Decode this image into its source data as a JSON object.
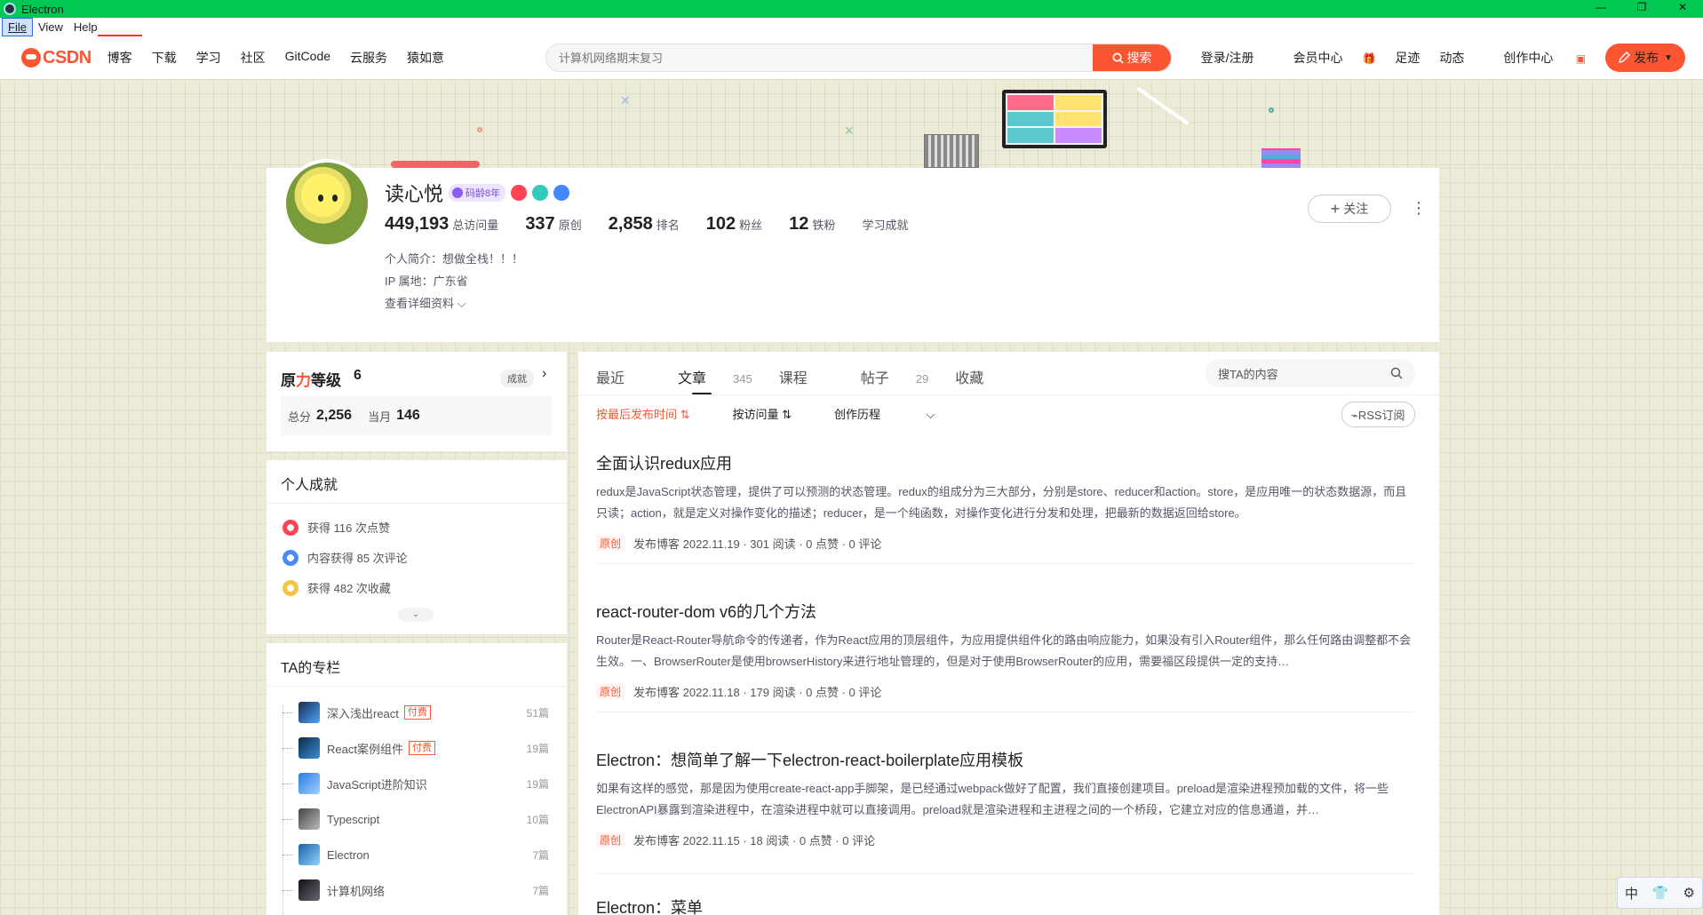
{
  "window": {
    "title": "Electron",
    "controls": [
      "—",
      "❐",
      "✕"
    ]
  },
  "menu": {
    "items": [
      "File",
      "View",
      "Help"
    ]
  },
  "toolbar": {
    "logo": "CSDN",
    "nav": [
      "博客",
      "下载",
      "学习",
      "社区",
      "GitCode",
      "云服务",
      "猿如意"
    ],
    "search_placeholder": "计算机网络期末复习",
    "search_button": "搜索",
    "right": [
      "登录/注册",
      "会员中心",
      "足迹",
      "动态",
      "创作中心"
    ],
    "publish": "发布"
  },
  "profile": {
    "name": "读心悦",
    "code_age": "码龄8年",
    "stats": [
      {
        "value": "449,193",
        "label": "总访问量"
      },
      {
        "value": "337",
        "label": "原创"
      },
      {
        "value": "2,858",
        "label": "排名"
      },
      {
        "value": "102",
        "label": "粉丝"
      },
      {
        "value": "12",
        "label": "铁粉"
      }
    ],
    "achievements_link": "学习成就",
    "intro": "个人简介：想做全栈！！！",
    "ip": "IP 属地：广东省",
    "details": "查看详细资料",
    "follow": "关注"
  },
  "level": {
    "title_prefix": "原",
    "title_highlight": "力",
    "title_suffix": "等级",
    "level": "6",
    "tag": "成就",
    "total_label": "总分",
    "total": "2,256",
    "month_label": "当月",
    "month": "146"
  },
  "achievements": {
    "title": "个人成就",
    "items": [
      "获得 116 次点赞",
      "内容获得 85 次评论",
      "获得 482 次收藏"
    ]
  },
  "columns": {
    "title": "TA的专栏",
    "items": [
      {
        "name": "深入浅出react",
        "paid": "付费",
        "count": "51篇"
      },
      {
        "name": "React案例组件",
        "paid": "付费",
        "count": "19篇"
      },
      {
        "name": "JavaScript进阶知识",
        "paid": "",
        "count": "19篇"
      },
      {
        "name": "Typescript",
        "paid": "",
        "count": "10篇"
      },
      {
        "name": "Electron",
        "paid": "",
        "count": "7篇"
      },
      {
        "name": "计算机网络",
        "paid": "",
        "count": "7篇"
      }
    ]
  },
  "main": {
    "tabs": [
      {
        "label": "最近",
        "count": ""
      },
      {
        "label": "文章",
        "count": "345"
      },
      {
        "label": "课程",
        "count": ""
      },
      {
        "label": "帖子",
        "count": "29"
      },
      {
        "label": "收藏",
        "count": ""
      }
    ],
    "search_placeholder": "搜TA的内容",
    "sorts": [
      "按最后发布时间 ⇅",
      "按访问量 ⇅",
      "创作历程"
    ],
    "rss": "RSS订阅",
    "articles": [
      {
        "title": "全面认识redux应用",
        "desc": "redux是JavaScript状态管理，提供了可以预测的状态管理。redux的组成分为三大部分，分别是store、reducer和action。store，是应用唯一的状态数据源，而且只读；action，就是定义对操作变化的描述；reducer，是一个纯函数，对操作变化进行分发和处理，把最新的数据返回给store。",
        "tag": "原创",
        "meta": "发布博客 2022.11.19 · 301 阅读 · 0 点赞 · 0 评论"
      },
      {
        "title": "react-router-dom v6的几个方法",
        "desc": "Router是React-Router导航命令的传递者，作为React应用的顶层组件，为应用提供组件化的路由响应能力，如果没有引入Router组件，那么任何路由调整都不会生效。一、BrowserRouter是使用browserHistory来进行地址管理的，但是对于使用BrowserRouter的应用，需要福区段提供一定的支持…",
        "tag": "原创",
        "meta": "发布博客 2022.11.18 · 179 阅读 · 0 点赞 · 0 评论"
      },
      {
        "title": "Electron：想简单了解一下electron-react-boilerplate应用模板",
        "desc": "如果有这样的感觉，那是因为使用create-react-app手脚架，是已经通过webpack做好了配置，我们直接创建项目。preload是渲染进程预加载的文件，将一些ElectronAPI暴露到渲染进程中，在渲染进程中就可以直接调用。preload就是渲染进程和主进程之间的一个桥段，它建立对应的信息通道，并…",
        "tag": "原创",
        "meta": "发布博客 2022.11.15 · 18 阅读 · 0 点赞 · 0 评论"
      },
      {
        "title": "Electron：菜单",
        "desc": "",
        "tag": "",
        "meta": ""
      }
    ]
  },
  "ime": {
    "label": "中"
  }
}
